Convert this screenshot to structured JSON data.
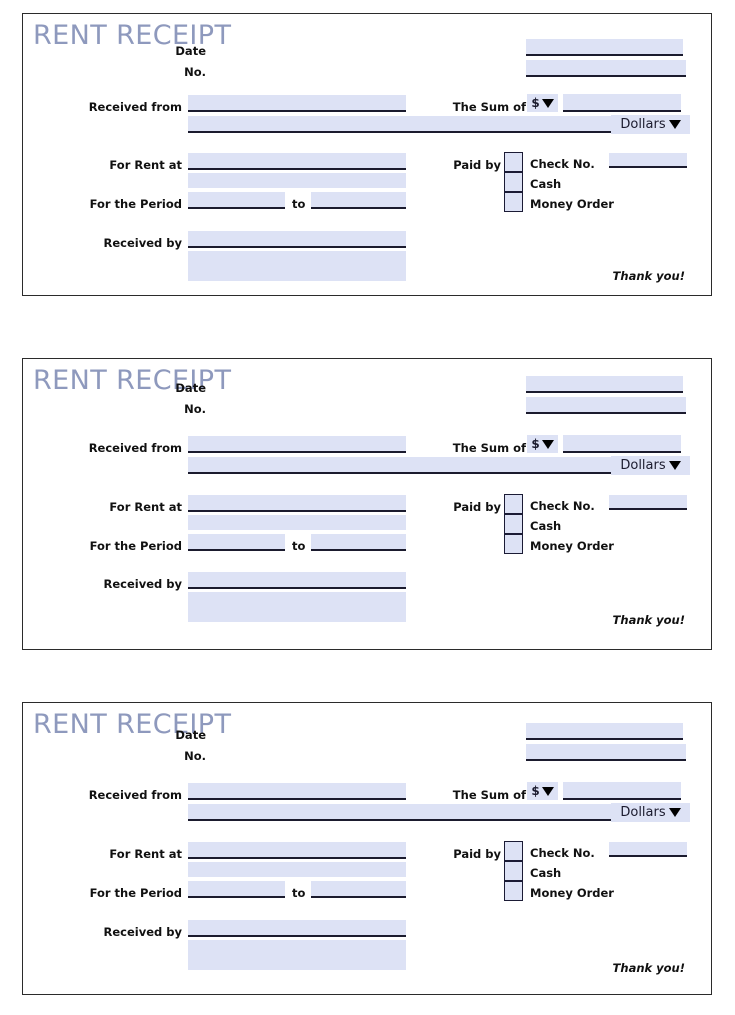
{
  "document": {
    "type": "rent-receipt-template",
    "copies": 3
  },
  "colors": {
    "title": "#8e99bd",
    "field_fill": "#dde2f5",
    "field_underline": "#1b1b2e",
    "card_border": "#2b2b2b",
    "label_text": "#111111"
  },
  "receipt": {
    "title": "RENT RECEIPT",
    "labels": {
      "date": "Date",
      "number": "No.",
      "received_from": "Received from",
      "the_sum_of": "The Sum of",
      "for_rent_at": "For Rent at",
      "for_the_period": "For the Period",
      "to": "to",
      "received_by": "Received by",
      "paid_by": "Paid by"
    },
    "dropdowns": {
      "currency_symbol": "$",
      "currency_unit": "Dollars",
      "caret_icon": "triangle-down-icon"
    },
    "payment_methods": [
      {
        "label": "Check No.",
        "has_field": true,
        "checked": false
      },
      {
        "label": "Cash",
        "has_field": false,
        "checked": false
      },
      {
        "label": "Money Order",
        "has_field": false,
        "checked": false
      }
    ],
    "values": {
      "date": "",
      "number": "",
      "received_from": "",
      "received_from_line2": "",
      "amount": "",
      "amount_in_words": "",
      "for_rent_at": "",
      "for_rent_at_line2": "",
      "period_from": "",
      "period_to": "",
      "received_by": "",
      "received_by_line2": "",
      "check_no": ""
    },
    "footer": "Thank you!"
  }
}
